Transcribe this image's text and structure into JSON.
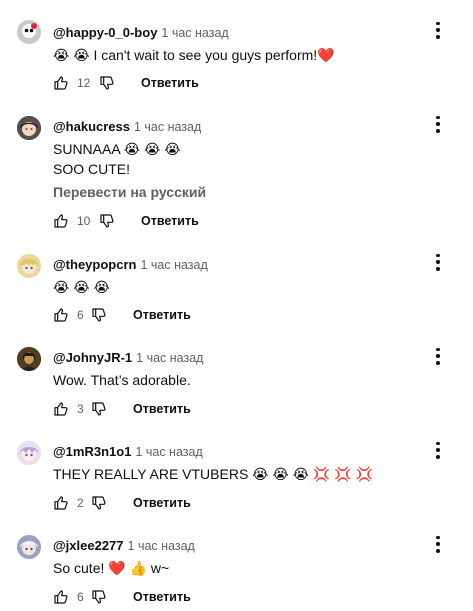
{
  "comments": [
    {
      "author": "@happy-0_0-boy",
      "time": "1 час назад",
      "lines": [
        "😭 😭  I can't wait to see you guys perform!❤️"
      ],
      "likes": "12",
      "reply": "Ответить",
      "avatar": "skull-avatar"
    },
    {
      "author": "@hakucress",
      "time": "1 час назад",
      "lines": [
        "SUNNAAA 😭 😭 😭",
        "SOO CUTE!"
      ],
      "translate": "Перевести на русский",
      "likes": "10",
      "reply": "Ответить",
      "avatar": "dark-hair-avatar"
    },
    {
      "author": "@theypopcrn",
      "time": "1 час назад",
      "lines": [
        "😭 😭 😭"
      ],
      "likes": "6",
      "reply": "Ответить",
      "avatar": "blonde-anime-avatar"
    },
    {
      "author": "@JohnyJR-1",
      "time": "1 час назад",
      "lines": [
        "Wow. That’s adorable."
      ],
      "likes": "3",
      "reply": "Ответить",
      "avatar": "painting-avatar"
    },
    {
      "author": "@1mR3n1o1",
      "time": "1 час назад",
      "lines": [
        "THEY REALLY ARE VTUBERS 😭 😭 😭 💢 💢 💢"
      ],
      "likes": "2",
      "reply": "Ответить",
      "avatar": "lilac-anime-avatar"
    },
    {
      "author": "@jxlee2277",
      "time": "1 час назад",
      "lines": [
        "So cute! ❤️ 👍 w~"
      ],
      "likes": "6",
      "reply": "Ответить",
      "avatar": "white-hair-avatar"
    }
  ],
  "icons": {
    "like": "thumbs-up-icon",
    "dislike": "thumbs-down-icon",
    "menu": "more-vert-icon"
  },
  "colors": {
    "text": "#0f0f0f",
    "secondary": "#606060"
  }
}
